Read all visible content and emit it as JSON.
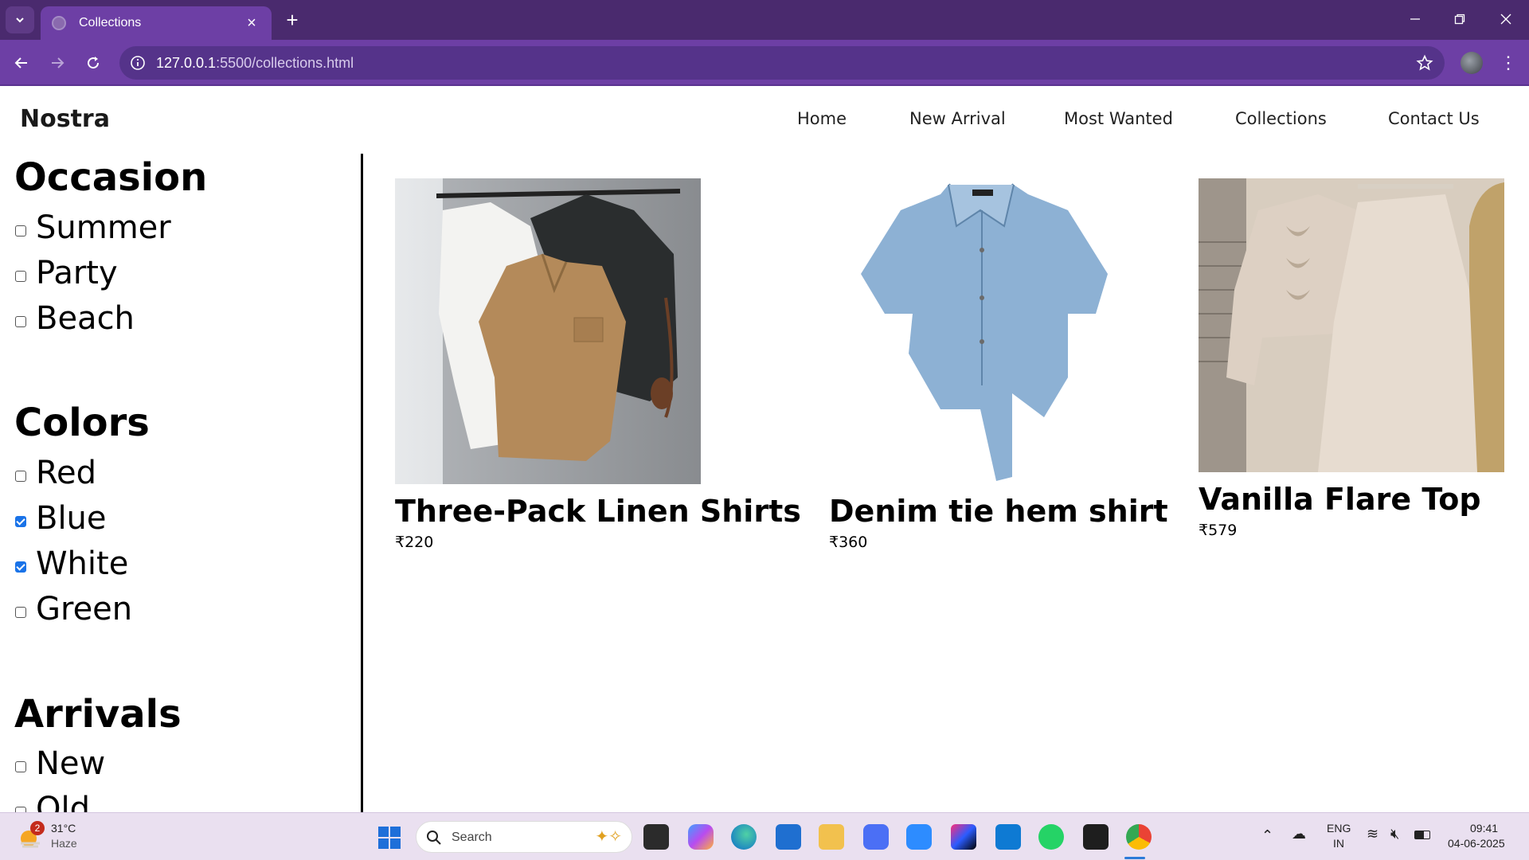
{
  "browser": {
    "tab_title": "Collections",
    "url_host": "127.0.0.1",
    "url_rest": ":5500/collections.html"
  },
  "site": {
    "brand": "Nostra",
    "nav": [
      "Home",
      "New Arrival",
      "Most Wanted",
      "Collections",
      "Contact Us"
    ]
  },
  "filters": {
    "occasion": {
      "heading": "Occasion",
      "items": [
        {
          "label": "Summer",
          "checked": false
        },
        {
          "label": "Party",
          "checked": false
        },
        {
          "label": "Beach",
          "checked": false
        }
      ]
    },
    "colors": {
      "heading": "Colors",
      "items": [
        {
          "label": "Red",
          "checked": false
        },
        {
          "label": "Blue",
          "checked": true
        },
        {
          "label": "White",
          "checked": true
        },
        {
          "label": "Green",
          "checked": false
        }
      ]
    },
    "arrivals": {
      "heading": "Arrivals",
      "items": [
        {
          "label": "New",
          "checked": false
        },
        {
          "label": "Old",
          "checked": false
        }
      ]
    }
  },
  "products": [
    {
      "title": "Three-Pack Linen Shirts",
      "price": "₹220"
    },
    {
      "title": "Denim tie hem shirt",
      "price": "₹360"
    },
    {
      "title": "Vanilla Flare Top",
      "price": "₹579"
    }
  ],
  "taskbar": {
    "weather_temp": "31°C",
    "weather_desc": "Haze",
    "weather_badge": "2",
    "search_placeholder": "Search",
    "lang_top": "ENG",
    "lang_bottom": "IN",
    "time": "09:41",
    "date": "04-06-2025"
  }
}
